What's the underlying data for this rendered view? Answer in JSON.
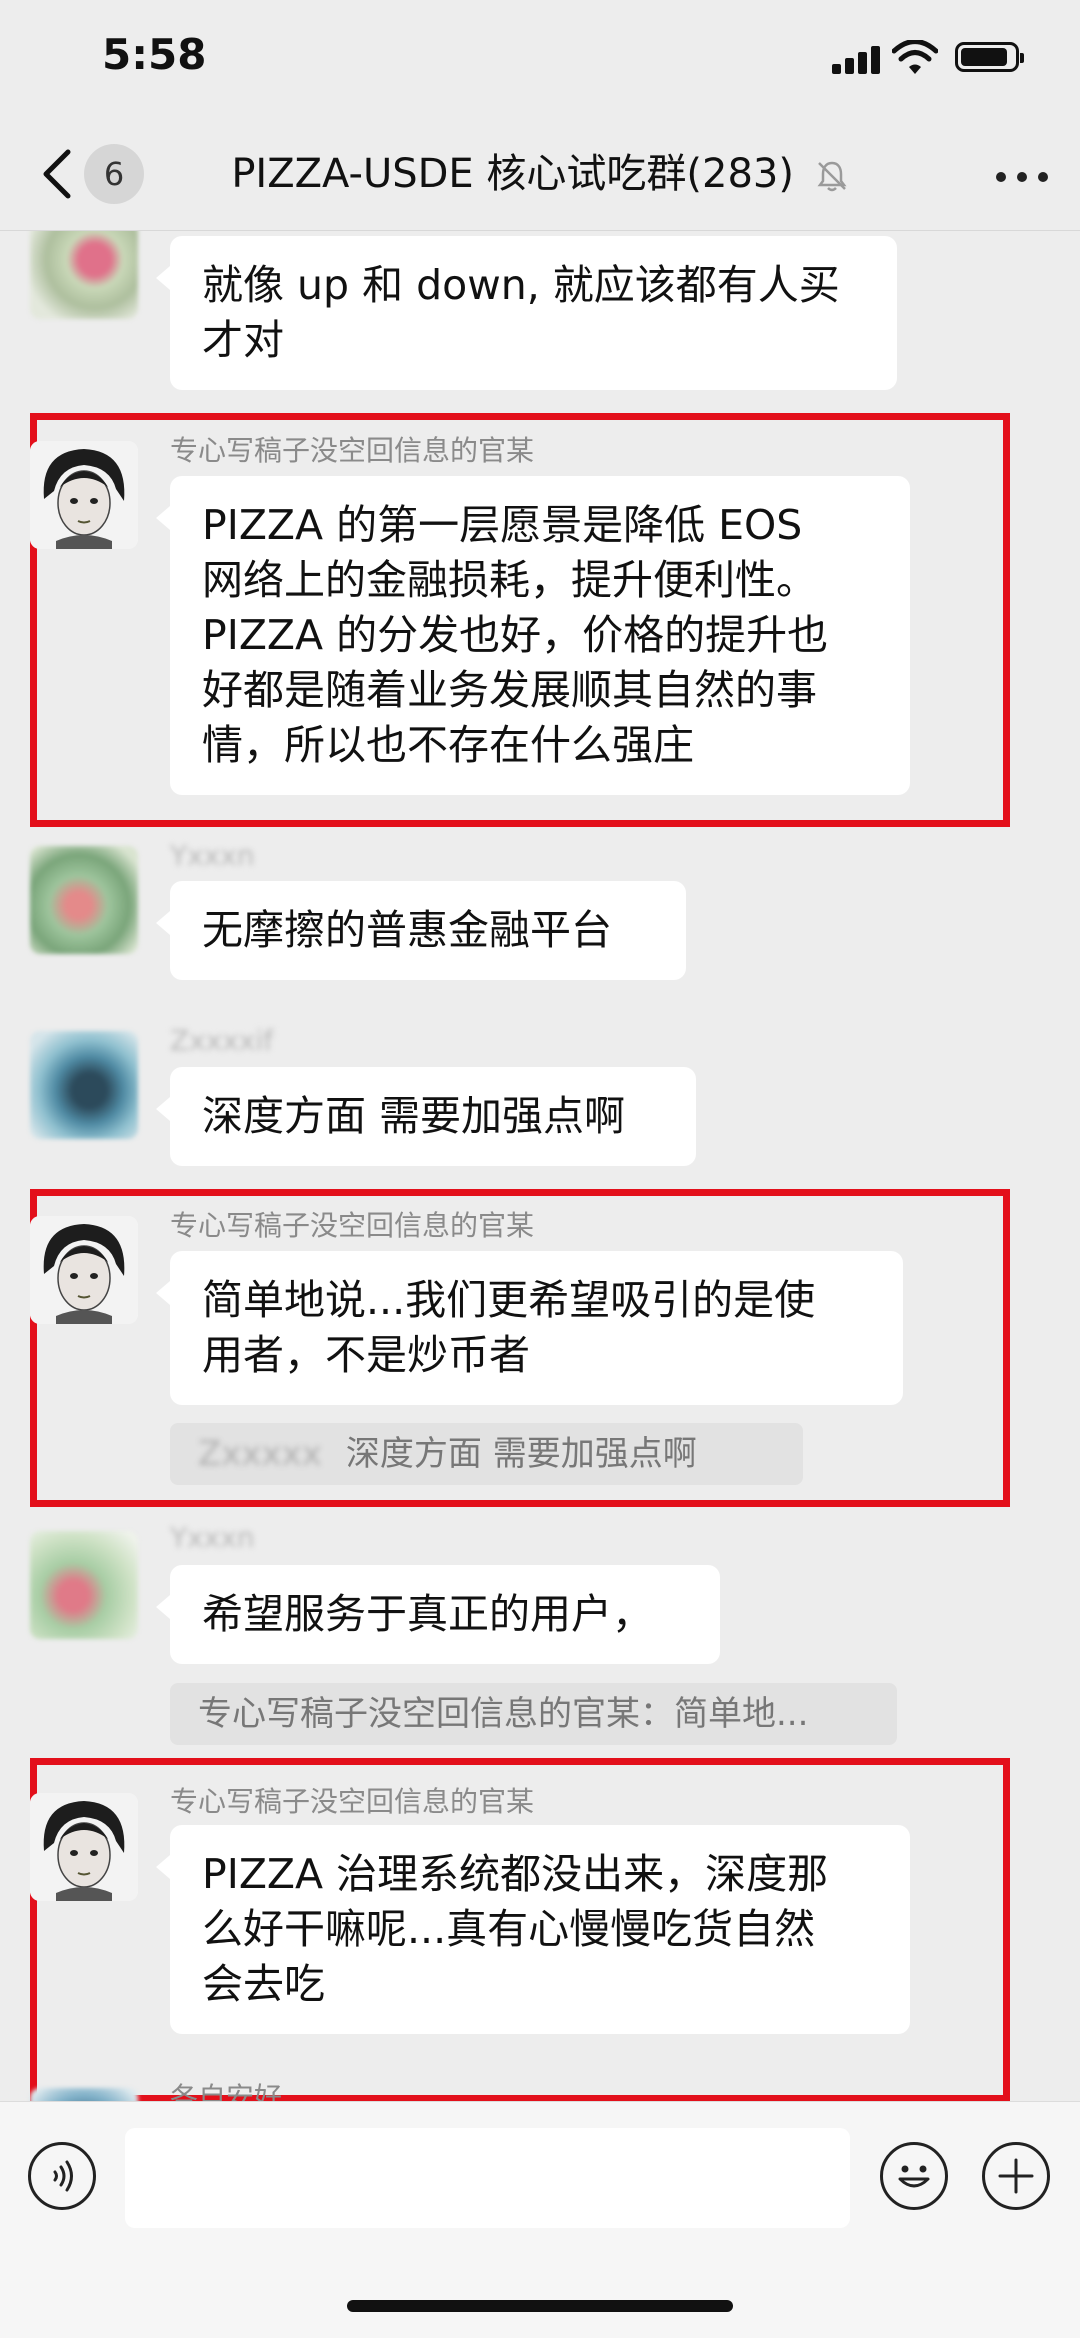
{
  "status_bar": {
    "time": "5:58"
  },
  "nav": {
    "unread_count": "6",
    "title": "PIZZA-USDE 核心试吃群(283)"
  },
  "messages": [
    {
      "sender": "",
      "text_lines": [
        "就像 up 和 down, 就应该都有人买",
        "才对"
      ]
    },
    {
      "sender": "专心写稿子没空回信息的官某",
      "text_lines": [
        "PIZZA 的第一层愿景是降低 EOS",
        "网络上的金融损耗，提升便利性。",
        "PIZZA 的分发也好，价格的提升也",
        "好都是随着业务发展顺其自然的事",
        "情，所以也不存在什么强庄"
      ]
    },
    {
      "sender": "Yxxxn",
      "text_lines": [
        "无摩擦的普惠金融平台"
      ]
    },
    {
      "sender": "Zxxxxif",
      "text_lines": [
        "深度方面 需要加强点啊"
      ]
    },
    {
      "sender": "专心写稿子没空回信息的官某",
      "text_lines": [
        "简单地说...我们更希望吸引的是使",
        "用者，不是炒币者"
      ],
      "quote_name": "Zxxxxx",
      "quote_text": "深度方面 需要加强点啊"
    },
    {
      "sender": "Yxxxn",
      "text_lines": [
        "希望服务于真正的用户，"
      ],
      "quote_text": "专心写稿子没空回信息的官某：简单地..."
    },
    {
      "sender": "专心写稿子没空回信息的官某",
      "text_lines": [
        "PIZZA 治理系统都没出来，深度那",
        "么好干嘛呢...真有心慢慢吃货自然",
        "会去吃"
      ]
    },
    {
      "sender": "各自安好",
      "text_lines": []
    }
  ],
  "icons": {
    "back": "chevron-left-icon",
    "mute": "bell-off-icon",
    "more": "more-dots-icon",
    "voice": "voice-icon",
    "emoji": "emoji-icon",
    "plus": "plus-icon"
  },
  "colors": {
    "highlight_box": "#e3101b",
    "chat_bg": "#ededed",
    "bubble": "#ffffff"
  }
}
